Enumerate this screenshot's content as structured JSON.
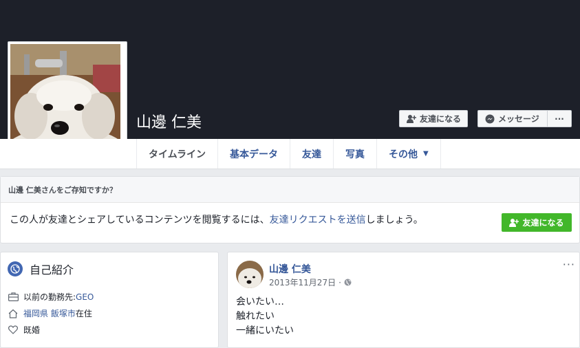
{
  "profile": {
    "name": "山邊 仁美"
  },
  "cover_actions": {
    "add_friend_label": "友達になる",
    "message_label": "メッセージ",
    "more_label": "···"
  },
  "tabs": [
    {
      "label": "タイムライン"
    },
    {
      "label": "基本データ"
    },
    {
      "label": "友達"
    },
    {
      "label": "写真"
    },
    {
      "label": "その他"
    }
  ],
  "friend_request": {
    "header": "山邊 仁美さんをご存知ですか？",
    "body_pre": "この人が友達とシェアしているコンテンツを閲覧するには、",
    "body_link": "友達リクエストを送信",
    "body_post": "しましょう。",
    "button_label": "友達になる"
  },
  "intro": {
    "title": "自己紹介",
    "work_prefix": "以前の勤務先: ",
    "work_link": "GEO",
    "location_link": "福岡県 飯塚市",
    "location_suffix": "在住",
    "relationship": "既婚"
  },
  "post": {
    "author": "山邊 仁美",
    "date": "2013年11月27日",
    "separator": "·",
    "more_label": "···",
    "lines": [
      "会いたい…",
      "触れたい",
      "一緒にいたい"
    ]
  },
  "colors": {
    "cover": "#1d2029",
    "link": "#365899",
    "green": "#42b72a",
    "page_bg": "#e9ebee"
  }
}
